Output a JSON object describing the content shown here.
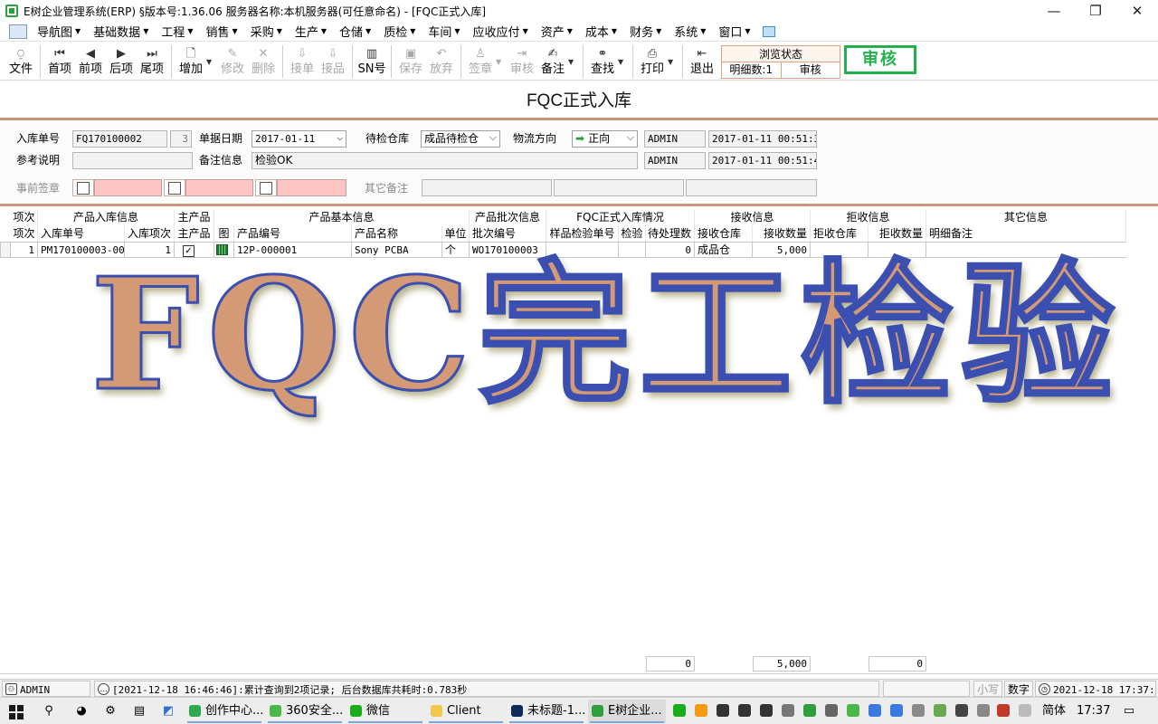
{
  "window": {
    "title": "E树企业管理系统(ERP) §版本号:1.36.06  服务器名称:本机服务器(可任意命名) - [FQC正式入库]",
    "minimize_icon": "minimize-icon",
    "restore_icon": "restore-icon",
    "close_icon": "close-icon"
  },
  "menu": [
    "导航图",
    "基础数据",
    "工程",
    "销售",
    "采购",
    "生产",
    "仓储",
    "质检",
    "车间",
    "应收应付",
    "资产",
    "成本",
    "财务",
    "系统",
    "窗口"
  ],
  "toolbar": {
    "buttons": [
      {
        "label": "文件",
        "icon": "paperclip-icon",
        "glyph": "⍜"
      },
      {
        "label": "首项",
        "icon": "first-icon",
        "glyph": "⏮"
      },
      {
        "label": "前项",
        "icon": "previous-icon",
        "glyph": "◀"
      },
      {
        "label": "后项",
        "icon": "next-icon",
        "glyph": "▶"
      },
      {
        "label": "尾项",
        "icon": "last-icon",
        "glyph": "⏭"
      },
      {
        "label": "增加",
        "icon": "add-icon",
        "glyph": "🗋"
      },
      {
        "label": "修改",
        "icon": "edit-icon",
        "glyph": "✎"
      },
      {
        "label": "删除",
        "icon": "delete-icon",
        "glyph": "✕"
      },
      {
        "label": "接单",
        "icon": "receive-order-icon",
        "glyph": "⇩"
      },
      {
        "label": "接品",
        "icon": "receive-item-icon",
        "glyph": "⇩"
      },
      {
        "label": "SN号",
        "icon": "barcode-icon",
        "glyph": "▥"
      },
      {
        "label": "保存",
        "icon": "save-icon",
        "glyph": "▣"
      },
      {
        "label": "放弃",
        "icon": "undo-icon",
        "glyph": "↶"
      },
      {
        "label": "签章",
        "icon": "stamp-icon",
        "glyph": "♙"
      },
      {
        "label": "审核",
        "icon": "audit-icon",
        "glyph": "⇥"
      },
      {
        "label": "备注",
        "icon": "note-icon",
        "glyph": "✍"
      },
      {
        "label": "查找",
        "icon": "binoculars-icon",
        "glyph": "⚭"
      },
      {
        "label": "打印",
        "icon": "printer-icon",
        "glyph": "⎙"
      },
      {
        "label": "退出",
        "icon": "exit-icon",
        "glyph": "⇤"
      }
    ],
    "state": {
      "title": "浏览状态",
      "detail_count": "明细数:1",
      "status": "审核"
    },
    "stamp": "审核"
  },
  "form": {
    "title": "FQC正式入库",
    "labels": {
      "doc_no": "入库单号",
      "doc_date": "单据日期",
      "warehouse": "待检仓库",
      "direction": "物流方向",
      "reference": "参考说明",
      "remark": "备注信息",
      "pre_sign": "事前签章",
      "other_remark": "其它备注"
    },
    "values": {
      "doc_no": "FQ170100002",
      "doc_seq": "3",
      "doc_date": "2017-01-11",
      "warehouse": "成品待检仓",
      "direction": "正向",
      "reference": "",
      "remark": "检验OK",
      "creator": "ADMIN",
      "created_at": "2017-01-11 00:51:38",
      "modifier": "ADMIN",
      "modified_at": "2017-01-11 00:51:41"
    }
  },
  "grid": {
    "groups": [
      "项次",
      "产品入库信息",
      "主产品",
      "产品基本信息",
      "产品批次信息",
      "FQC正式入库情况",
      "接收信息",
      "拒收信息",
      "其它信息"
    ],
    "columns": [
      "项次",
      "入库单号",
      "入库项次",
      "主产品",
      "图",
      "产品编号",
      "产品名称",
      "单位",
      "批次编号",
      "样品检验单号",
      "检验",
      "待处理数",
      "接收仓库",
      "接收数量",
      "拒收仓库",
      "拒收数量",
      "明细备注"
    ],
    "rows": [
      {
        "seq": "1",
        "doc_no": "PM170100003-001",
        "doc_seq": "1",
        "main_product": "✓",
        "product_no": "12P-000001",
        "product_name": "Sony PCBA",
        "unit": "个",
        "batch_no": "WO170100003",
        "sample_no": "",
        "inspect": "",
        "pending": "0",
        "recv_wh": "成品仓",
        "recv_qty": "5,000",
        "rej_wh": "",
        "rej_qty": "",
        "memo": ""
      }
    ],
    "totals": {
      "pending": "0",
      "recv_qty": "5,000",
      "rej_qty": "0"
    }
  },
  "watermark": "FQC完工检验",
  "statusbar": {
    "user": "ADMIN",
    "message": "[2021-12-18 16:46:46]:累计查询到2项记录; 后台数据库共耗时:0.783秒",
    "caps": "小写",
    "num": "数字",
    "datetime": "2021-12-18 17:37:41"
  },
  "taskbar": {
    "apps": [
      {
        "label": "创作中心...",
        "color": "#2fa84f"
      },
      {
        "label": "360安全...",
        "color": "#49b848"
      },
      {
        "label": "微信",
        "color": "#1aad19"
      },
      {
        "label": "Client",
        "color": "#f2c84b"
      },
      {
        "label": "未标题-1...",
        "color": "#0c2b5a"
      },
      {
        "label": "E树企业...",
        "color": "#2e9e3e"
      }
    ],
    "ime": "简体",
    "time": "17:37"
  }
}
